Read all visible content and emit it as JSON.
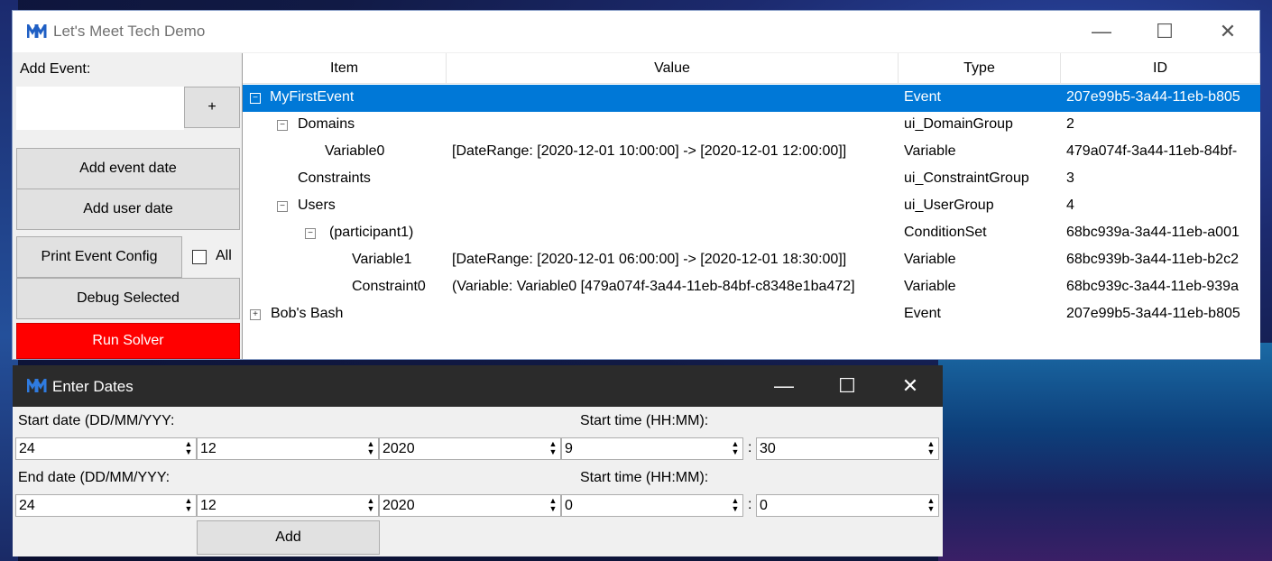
{
  "main_window": {
    "title": "Let's Meet Tech Demo",
    "controls": {
      "minimize": "—",
      "maximize": "☐",
      "close": "✕"
    }
  },
  "left_panel": {
    "add_event_label": "Add Event:",
    "event_name_value": "",
    "plus_button": "+",
    "add_event_date": "Add event date",
    "add_user_date": "Add user date",
    "print_event_config": "Print Event Config",
    "all_checkbox_label": "All",
    "debug_selected": "Debug Selected",
    "run_solver": "Run Solver",
    "run_solver_color": "#ff0000"
  },
  "tree": {
    "columns": [
      "Item",
      "Value",
      "Type",
      "ID"
    ],
    "rows": [
      {
        "item": "MyFirstEvent",
        "value": "",
        "type": "Event",
        "id": "207e99b5-3a44-11eb-b805",
        "expander": "−",
        "selected": true
      },
      {
        "item": "Domains",
        "value": "",
        "type": "ui_DomainGroup",
        "id": "2",
        "expander": "−"
      },
      {
        "item": "Variable0",
        "value": "[DateRange: [2020-12-01 10:00:00] -> [2020-12-01 12:00:00]]",
        "type": "Variable",
        "id": "479a074f-3a44-11eb-84bf-",
        "expander": ""
      },
      {
        "item": "Constraints",
        "value": "",
        "type": "ui_ConstraintGroup",
        "id": "3",
        "expander": ""
      },
      {
        "item": "Users",
        "value": "",
        "type": "ui_UserGroup",
        "id": "4",
        "expander": "−"
      },
      {
        "item": "(participant1)",
        "value": "",
        "type": "ConditionSet",
        "id": "68bc939a-3a44-11eb-a001",
        "expander": "−"
      },
      {
        "item": "Variable1",
        "value": "[DateRange: [2020-12-01 06:00:00] -> [2020-12-01 18:30:00]]",
        "type": "Variable",
        "id": "68bc939b-3a44-11eb-b2c2",
        "expander": ""
      },
      {
        "item": "Constraint0",
        "value": "(Variable: Variable0 [479a074f-3a44-11eb-84bf-c8348e1ba472]",
        "type": "Variable",
        "id": "68bc939c-3a44-11eb-939a",
        "expander": ""
      },
      {
        "item": "Bob's Bash",
        "value": "",
        "type": "Event",
        "id": "207e99b5-3a44-11eb-b805",
        "expander": "+"
      }
    ],
    "selection_color": "#0078d7"
  },
  "dialog": {
    "title": "Enter Dates",
    "start_date_label": "Start date (DD/MM/YYY:",
    "start_time_label": "Start time (HH:MM):",
    "end_date_label": "End date (DD/MM/YYY:",
    "end_time_label": "Start time (HH:MM):",
    "start": {
      "day": "24",
      "month": "12",
      "year": "2020",
      "hour": "9",
      "minute": "30"
    },
    "end": {
      "day": "24",
      "month": "12",
      "year": "2020",
      "hour": "0",
      "minute": "0"
    },
    "colon": ":",
    "add_button": "Add"
  }
}
